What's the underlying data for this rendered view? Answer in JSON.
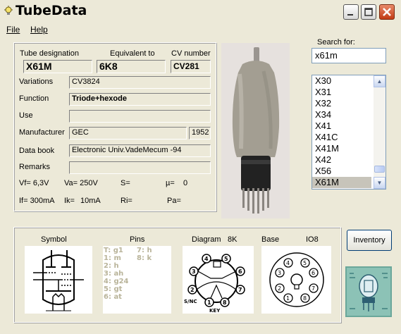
{
  "window": {
    "title": "TubeData"
  },
  "menu": [
    {
      "label": "File"
    },
    {
      "label": "Help"
    }
  ],
  "labels": {
    "tube_designation": "Tube designation",
    "equivalent_to": "Equivalent to",
    "cv_number": "CV number",
    "variations": "Variations",
    "function": "Function",
    "use": "Use",
    "manufacturer": "Manufacturer",
    "data_book": "Data book",
    "remarks": "Remarks",
    "search_for": "Search for:",
    "symbol": "Symbol",
    "pins": "Pins",
    "diagram": "Diagram",
    "base": "Base"
  },
  "tube": {
    "designation": "X61M",
    "equivalent": "6K8",
    "cv_number": "CV281",
    "variations": "CV3824",
    "function": "Triode+hexode",
    "use": "",
    "manufacturer": "GEC",
    "year": "1952",
    "data_book": "Electronic Univ.VadeMecum -94",
    "remarks": ""
  },
  "params": {
    "vf": "Vf= 6,3V",
    "va": "Va= 250V",
    "s": "S=",
    "mu": "µ=",
    "mu_val": "0",
    "if": "If= 300mA",
    "ik": "Ik=",
    "ik_val": "10mA",
    "ri": "Ri=",
    "pa": "Pa="
  },
  "search": {
    "value": "x61m"
  },
  "list_items": [
    "X30",
    "X31",
    "X32",
    "X34",
    "X41",
    "X41C",
    "X41M",
    "X42",
    "X56",
    "X61M"
  ],
  "selected_item": "X61M",
  "diagram_code": "8K",
  "base_code": "IO8",
  "pins_left": [
    "T: g1",
    "1: m",
    "2: h",
    "3: ah",
    "4: g24",
    "5: gt",
    "6: at"
  ],
  "pins_right": [
    "7: h",
    "8: k"
  ],
  "diagram_texts": {
    "snc": "S/NC",
    "key": "KEY"
  },
  "inventory_button": "Inventory",
  "colors": {
    "close_button": "#c23b14",
    "selection": "#c7c4ba",
    "pins_text": "#b9b49a"
  }
}
